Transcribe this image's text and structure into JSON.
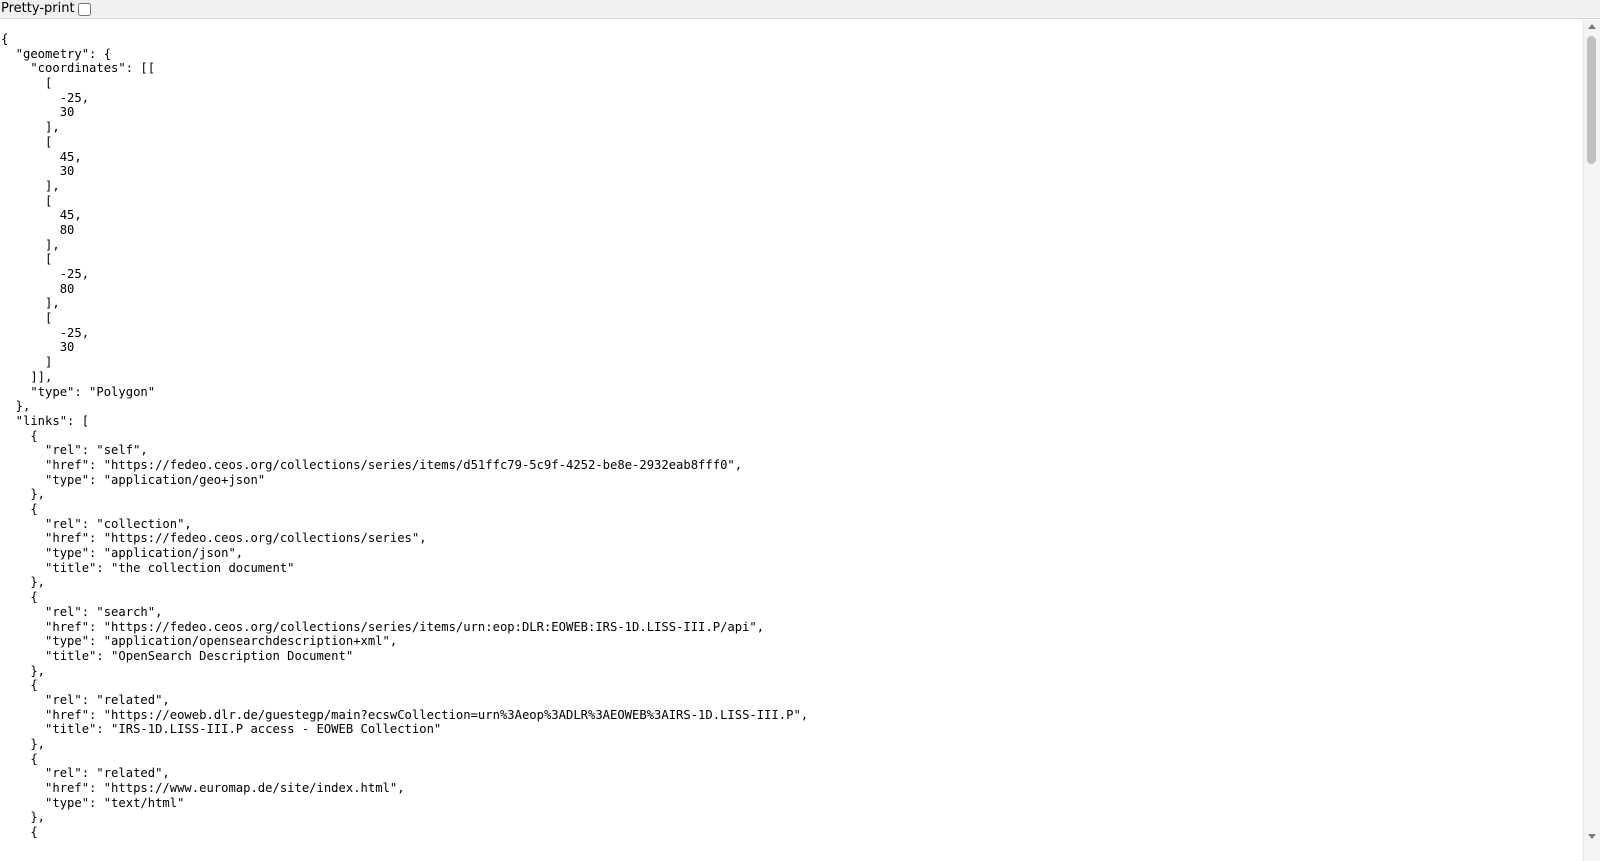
{
  "toolbar": {
    "pretty_print_label": "Pretty-print",
    "pretty_print_checked": false
  },
  "document": {
    "lines": [
      "{",
      "  \"geometry\": {",
      "    \"coordinates\": [[",
      "      [",
      "        -25,",
      "        30",
      "      ],",
      "      [",
      "        45,",
      "        30",
      "      ],",
      "      [",
      "        45,",
      "        80",
      "      ],",
      "      [",
      "        -25,",
      "        80",
      "      ],",
      "      [",
      "        -25,",
      "        30",
      "      ]",
      "    ]],",
      "    \"type\": \"Polygon\"",
      "  },",
      "  \"links\": [",
      "    {",
      "      \"rel\": \"self\",",
      "      \"href\": \"https://fedeo.ceos.org/collections/series/items/d51ffc79-5c9f-4252-be8e-2932eab8fff0\",",
      "      \"type\": \"application/geo+json\"",
      "    },",
      "    {",
      "      \"rel\": \"collection\",",
      "      \"href\": \"https://fedeo.ceos.org/collections/series\",",
      "      \"type\": \"application/json\",",
      "      \"title\": \"the collection document\"",
      "    },",
      "    {",
      "      \"rel\": \"search\",",
      "      \"href\": \"https://fedeo.ceos.org/collections/series/items/urn:eop:DLR:EOWEB:IRS-1D.LISS-III.P/api\",",
      "      \"type\": \"application/opensearchdescription+xml\",",
      "      \"title\": \"OpenSearch Description Document\"",
      "    },",
      "    {",
      "      \"rel\": \"related\",",
      "      \"href\": \"https://eoweb.dlr.de/guestegp/main?ecswCollection=urn%3Aeop%3ADLR%3AEOWEB%3AIRS-1D.LISS-III.P\",",
      "      \"title\": \"IRS-1D.LISS-III.P access - EOWEB Collection\"",
      "    },",
      "    {",
      "      \"rel\": \"related\",",
      "      \"href\": \"https://www.euromap.de/site/index.html\",",
      "      \"type\": \"text/html\"",
      "    },",
      "    {"
    ]
  },
  "scrollbar": {
    "up_icon": "scroll-up-arrow",
    "down_icon": "scroll-down-arrow"
  }
}
